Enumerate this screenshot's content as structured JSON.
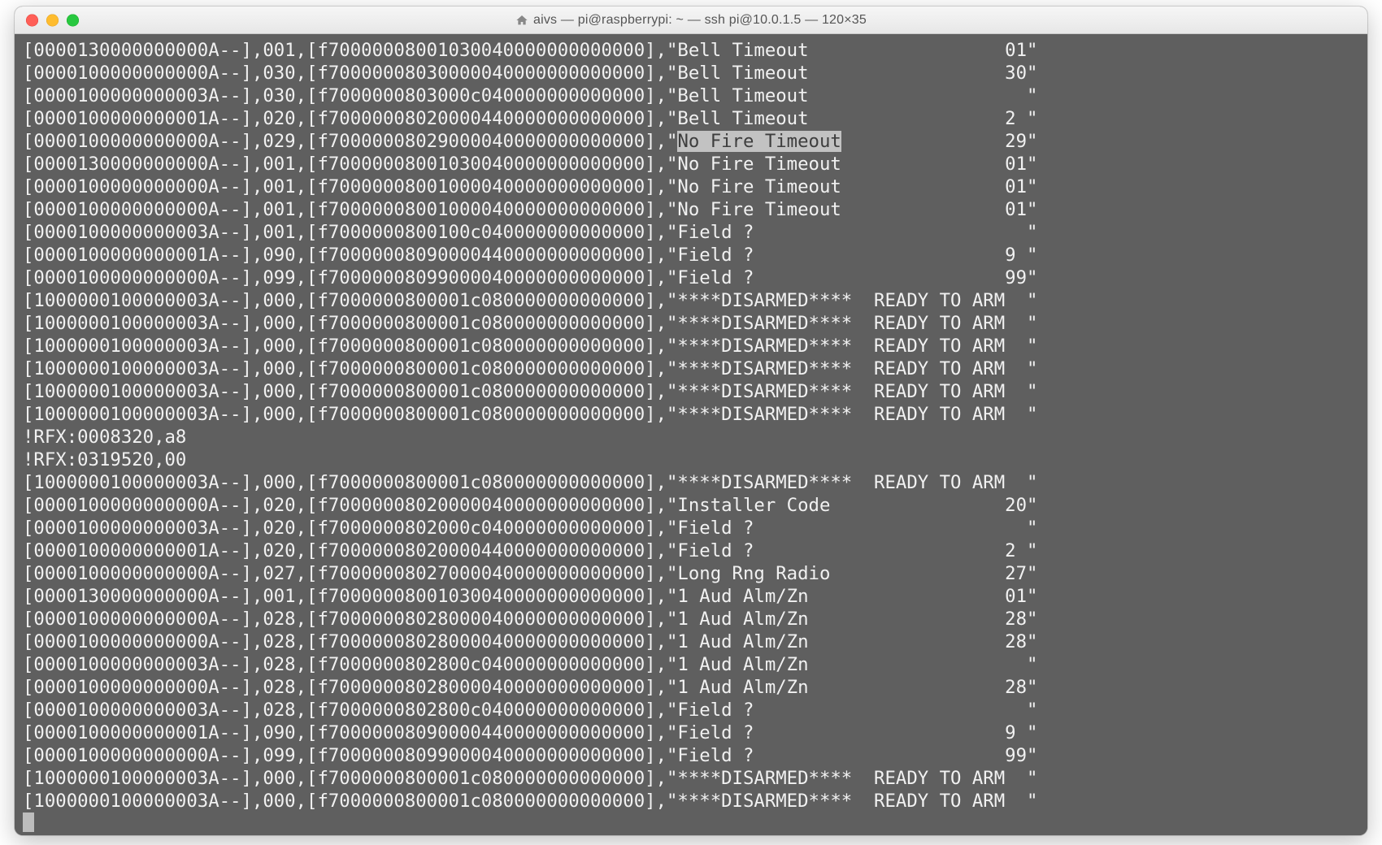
{
  "window": {
    "title": "aivs — pi@raspberrypi: ~ — ssh pi@10.0.1.5 — 120×35"
  },
  "highlight_text": "No Fire Timeout",
  "lines": [
    {
      "c1": "0000130000000000A--",
      "c2": "001",
      "c3": "f70000008001030040000000000000",
      "label": "Bell Timeout",
      "val": "01"
    },
    {
      "c1": "0000100000000000A--",
      "c2": "030",
      "c3": "f70000008030000040000000000000",
      "label": "Bell Timeout",
      "val": "30"
    },
    {
      "c1": "0000100000000003A--",
      "c2": "030",
      "c3": "f7000000803000c040000000000000",
      "label": "Bell Timeout",
      "val": "  "
    },
    {
      "c1": "0000100000000001A--",
      "c2": "020",
      "c3": "f70000008020000440000000000000",
      "label": "Bell Timeout",
      "val": "2 "
    },
    {
      "c1": "0000100000000000A--",
      "c2": "029",
      "c3": "f70000008029000040000000000000",
      "label": "No Fire Timeout",
      "val": "29",
      "hl": true
    },
    {
      "c1": "0000130000000000A--",
      "c2": "001",
      "c3": "f70000008001030040000000000000",
      "label": "No Fire Timeout",
      "val": "01"
    },
    {
      "c1": "0000100000000000A--",
      "c2": "001",
      "c3": "f70000008001000040000000000000",
      "label": "No Fire Timeout",
      "val": "01"
    },
    {
      "c1": "0000100000000000A--",
      "c2": "001",
      "c3": "f70000008001000040000000000000",
      "label": "No Fire Timeout",
      "val": "01"
    },
    {
      "c1": "0000100000000003A--",
      "c2": "001",
      "c3": "f7000000800100c040000000000000",
      "label": "Field ?",
      "val": "  "
    },
    {
      "c1": "0000100000000001A--",
      "c2": "090",
      "c3": "f70000008090000440000000000000",
      "label": "Field ?",
      "val": "9 "
    },
    {
      "c1": "0000100000000000A--",
      "c2": "099",
      "c3": "f70000008099000040000000000000",
      "label": "Field ?",
      "val": "99"
    },
    {
      "c1": "1000000100000003A--",
      "c2": "000",
      "c3": "f7000000800001c080000000000000",
      "label": "****DISARMED****  READY TO ARM",
      "val": "  "
    },
    {
      "c1": "1000000100000003A--",
      "c2": "000",
      "c3": "f7000000800001c080000000000000",
      "label": "****DISARMED****  READY TO ARM",
      "val": "  "
    },
    {
      "c1": "1000000100000003A--",
      "c2": "000",
      "c3": "f7000000800001c080000000000000",
      "label": "****DISARMED****  READY TO ARM",
      "val": "  "
    },
    {
      "c1": "1000000100000003A--",
      "c2": "000",
      "c3": "f7000000800001c080000000000000",
      "label": "****DISARMED****  READY TO ARM",
      "val": "  "
    },
    {
      "c1": "1000000100000003A--",
      "c2": "000",
      "c3": "f7000000800001c080000000000000",
      "label": "****DISARMED****  READY TO ARM",
      "val": "  "
    },
    {
      "c1": "1000000100000003A--",
      "c2": "000",
      "c3": "f7000000800001c080000000000000",
      "label": "****DISARMED****  READY TO ARM",
      "val": "  "
    },
    {
      "raw": "!RFX:0008320,a8"
    },
    {
      "raw": "!RFX:0319520,00"
    },
    {
      "c1": "1000000100000003A--",
      "c2": "000",
      "c3": "f7000000800001c080000000000000",
      "label": "****DISARMED****  READY TO ARM",
      "val": "  "
    },
    {
      "c1": "0000100000000000A--",
      "c2": "020",
      "c3": "f70000008020000040000000000000",
      "label": "Installer Code",
      "val": "20"
    },
    {
      "c1": "0000100000000003A--",
      "c2": "020",
      "c3": "f7000000802000c040000000000000",
      "label": "Field ?",
      "val": "  "
    },
    {
      "c1": "0000100000000001A--",
      "c2": "020",
      "c3": "f70000008020000440000000000000",
      "label": "Field ?",
      "val": "2 "
    },
    {
      "c1": "0000100000000000A--",
      "c2": "027",
      "c3": "f70000008027000040000000000000",
      "label": "Long Rng Radio",
      "val": "27"
    },
    {
      "c1": "0000130000000000A--",
      "c2": "001",
      "c3": "f70000008001030040000000000000",
      "label": "1 Aud Alm/Zn",
      "val": "01"
    },
    {
      "c1": "0000100000000000A--",
      "c2": "028",
      "c3": "f70000008028000040000000000000",
      "label": "1 Aud Alm/Zn",
      "val": "28"
    },
    {
      "c1": "0000100000000000A--",
      "c2": "028",
      "c3": "f70000008028000040000000000000",
      "label": "1 Aud Alm/Zn",
      "val": "28"
    },
    {
      "c1": "0000100000000003A--",
      "c2": "028",
      "c3": "f7000000802800c040000000000000",
      "label": "1 Aud Alm/Zn",
      "val": "  "
    },
    {
      "c1": "0000100000000000A--",
      "c2": "028",
      "c3": "f70000008028000040000000000000",
      "label": "1 Aud Alm/Zn",
      "val": "28"
    },
    {
      "c1": "0000100000000003A--",
      "c2": "028",
      "c3": "f7000000802800c040000000000000",
      "label": "Field ?",
      "val": "  "
    },
    {
      "c1": "0000100000000001A--",
      "c2": "090",
      "c3": "f70000008090000440000000000000",
      "label": "Field ?",
      "val": "9 "
    },
    {
      "c1": "0000100000000000A--",
      "c2": "099",
      "c3": "f70000008099000040000000000000",
      "label": "Field ?",
      "val": "99"
    },
    {
      "c1": "1000000100000003A--",
      "c2": "000",
      "c3": "f7000000800001c080000000000000",
      "label": "****DISARMED****  READY TO ARM",
      "val": "  "
    },
    {
      "c1": "1000000100000003A--",
      "c2": "000",
      "c3": "f7000000800001c080000000000000",
      "label": "****DISARMED****  READY TO ARM",
      "val": "  "
    }
  ]
}
